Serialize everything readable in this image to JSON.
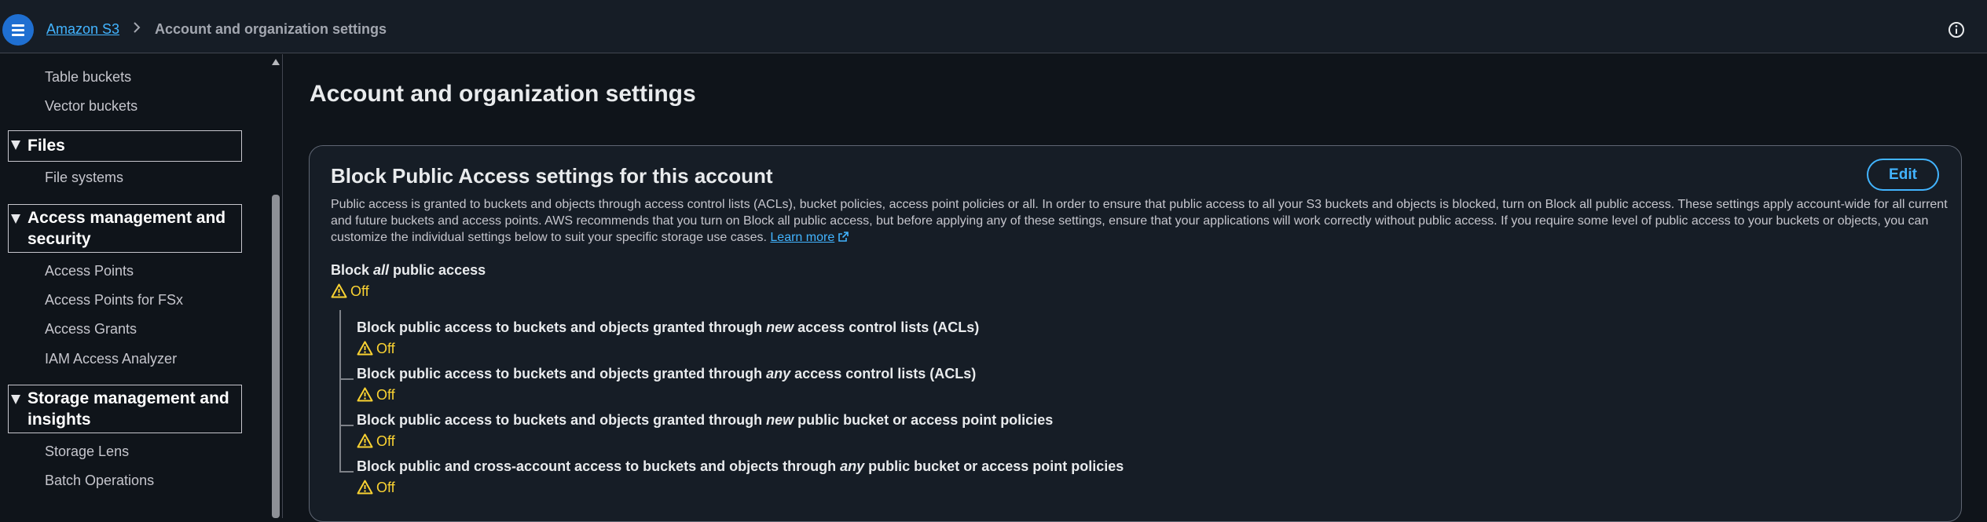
{
  "header": {
    "breadcrumb_root": "Amazon S3",
    "breadcrumb_current": "Account and organization settings"
  },
  "sidebar": {
    "items_top": [
      "Table buckets",
      "Vector buckets"
    ],
    "sections": [
      {
        "label": "Files",
        "items": [
          "File systems"
        ]
      },
      {
        "label_line1": "Access management and",
        "label_line2": "security",
        "items": [
          "Access Points",
          "Access Points for FSx",
          "Access Grants",
          "IAM Access Analyzer"
        ]
      },
      {
        "label_line1": "Storage management and",
        "label_line2": "insights",
        "items": [
          "Storage Lens",
          "Batch Operations"
        ]
      }
    ]
  },
  "main": {
    "page_title": "Account and organization settings",
    "card": {
      "title": "Block Public Access settings for this account",
      "edit_label": "Edit",
      "description": "Public access is granted to buckets and objects through access control lists (ACLs), bucket policies, access point policies or all. In order to ensure that public access to all your S3 buckets and objects is blocked, turn on Block all public access. These settings apply account-wide for all current and future buckets and access points. AWS recommends that you turn on Block all public access, but before applying any of these settings, ensure that your applications will work correctly without public access. If you require some level of public access to your buckets or objects, you can customize the individual settings below to suit your specific storage use cases.",
      "learn_more": "Learn more",
      "block_all": {
        "prefix": "Block ",
        "emphasis": "all",
        "suffix": " public access",
        "status": "Off"
      },
      "settings": [
        {
          "prefix": "Block public access to buckets and objects granted through ",
          "emphasis": "new",
          "suffix": " access control lists (ACLs)",
          "status": "Off"
        },
        {
          "prefix": "Block public access to buckets and objects granted through ",
          "emphasis": "any",
          "suffix": " access control lists (ACLs)",
          "status": "Off"
        },
        {
          "prefix": "Block public access to buckets and objects granted through ",
          "emphasis": "new",
          "suffix": " public bucket or access point policies",
          "status": "Off"
        },
        {
          "prefix": "Block public and cross-account access to buckets and objects through ",
          "emphasis": "any",
          "suffix": " public bucket or access point policies",
          "status": "Off"
        }
      ]
    }
  },
  "colors": {
    "link": "#42b4ff",
    "warning": "#fbd332",
    "background": "#0f141a",
    "card_bg": "#161d26",
    "menu_button": "#1f6fd1"
  },
  "icons": [
    "menu-icon",
    "chevron-right-icon",
    "info-icon",
    "caret-down-icon",
    "external-link-icon",
    "warning-icon"
  ]
}
